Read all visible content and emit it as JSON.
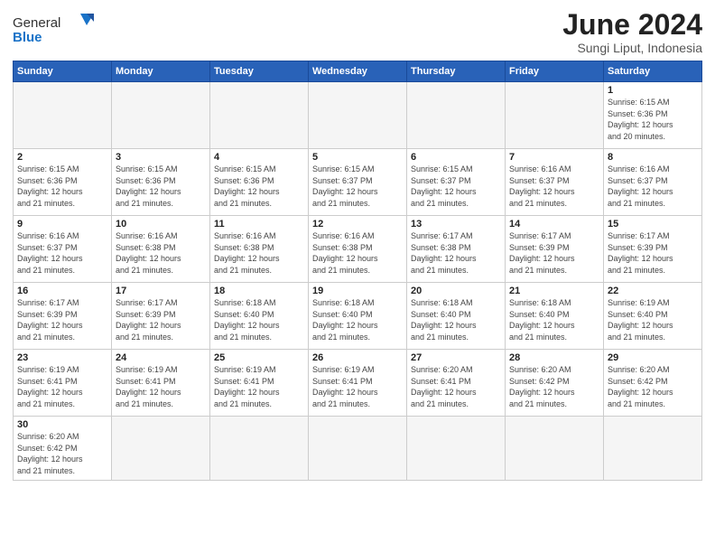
{
  "header": {
    "logo_general": "General",
    "logo_blue": "Blue",
    "month_title": "June 2024",
    "subtitle": "Sungi Liput, Indonesia"
  },
  "weekdays": [
    "Sunday",
    "Monday",
    "Tuesday",
    "Wednesday",
    "Thursday",
    "Friday",
    "Saturday"
  ],
  "days": {
    "d1": {
      "num": "1",
      "info": "Sunrise: 6:15 AM\nSunset: 6:36 PM\nDaylight: 12 hours\nand 20 minutes."
    },
    "d2": {
      "num": "2",
      "info": "Sunrise: 6:15 AM\nSunset: 6:36 PM\nDaylight: 12 hours\nand 21 minutes."
    },
    "d3": {
      "num": "3",
      "info": "Sunrise: 6:15 AM\nSunset: 6:36 PM\nDaylight: 12 hours\nand 21 minutes."
    },
    "d4": {
      "num": "4",
      "info": "Sunrise: 6:15 AM\nSunset: 6:36 PM\nDaylight: 12 hours\nand 21 minutes."
    },
    "d5": {
      "num": "5",
      "info": "Sunrise: 6:15 AM\nSunset: 6:37 PM\nDaylight: 12 hours\nand 21 minutes."
    },
    "d6": {
      "num": "6",
      "info": "Sunrise: 6:15 AM\nSunset: 6:37 PM\nDaylight: 12 hours\nand 21 minutes."
    },
    "d7": {
      "num": "7",
      "info": "Sunrise: 6:16 AM\nSunset: 6:37 PM\nDaylight: 12 hours\nand 21 minutes."
    },
    "d8": {
      "num": "8",
      "info": "Sunrise: 6:16 AM\nSunset: 6:37 PM\nDaylight: 12 hours\nand 21 minutes."
    },
    "d9": {
      "num": "9",
      "info": "Sunrise: 6:16 AM\nSunset: 6:37 PM\nDaylight: 12 hours\nand 21 minutes."
    },
    "d10": {
      "num": "10",
      "info": "Sunrise: 6:16 AM\nSunset: 6:38 PM\nDaylight: 12 hours\nand 21 minutes."
    },
    "d11": {
      "num": "11",
      "info": "Sunrise: 6:16 AM\nSunset: 6:38 PM\nDaylight: 12 hours\nand 21 minutes."
    },
    "d12": {
      "num": "12",
      "info": "Sunrise: 6:16 AM\nSunset: 6:38 PM\nDaylight: 12 hours\nand 21 minutes."
    },
    "d13": {
      "num": "13",
      "info": "Sunrise: 6:17 AM\nSunset: 6:38 PM\nDaylight: 12 hours\nand 21 minutes."
    },
    "d14": {
      "num": "14",
      "info": "Sunrise: 6:17 AM\nSunset: 6:39 PM\nDaylight: 12 hours\nand 21 minutes."
    },
    "d15": {
      "num": "15",
      "info": "Sunrise: 6:17 AM\nSunset: 6:39 PM\nDaylight: 12 hours\nand 21 minutes."
    },
    "d16": {
      "num": "16",
      "info": "Sunrise: 6:17 AM\nSunset: 6:39 PM\nDaylight: 12 hours\nand 21 minutes."
    },
    "d17": {
      "num": "17",
      "info": "Sunrise: 6:17 AM\nSunset: 6:39 PM\nDaylight: 12 hours\nand 21 minutes."
    },
    "d18": {
      "num": "18",
      "info": "Sunrise: 6:18 AM\nSunset: 6:40 PM\nDaylight: 12 hours\nand 21 minutes."
    },
    "d19": {
      "num": "19",
      "info": "Sunrise: 6:18 AM\nSunset: 6:40 PM\nDaylight: 12 hours\nand 21 minutes."
    },
    "d20": {
      "num": "20",
      "info": "Sunrise: 6:18 AM\nSunset: 6:40 PM\nDaylight: 12 hours\nand 21 minutes."
    },
    "d21": {
      "num": "21",
      "info": "Sunrise: 6:18 AM\nSunset: 6:40 PM\nDaylight: 12 hours\nand 21 minutes."
    },
    "d22": {
      "num": "22",
      "info": "Sunrise: 6:19 AM\nSunset: 6:40 PM\nDaylight: 12 hours\nand 21 minutes."
    },
    "d23": {
      "num": "23",
      "info": "Sunrise: 6:19 AM\nSunset: 6:41 PM\nDaylight: 12 hours\nand 21 minutes."
    },
    "d24": {
      "num": "24",
      "info": "Sunrise: 6:19 AM\nSunset: 6:41 PM\nDaylight: 12 hours\nand 21 minutes."
    },
    "d25": {
      "num": "25",
      "info": "Sunrise: 6:19 AM\nSunset: 6:41 PM\nDaylight: 12 hours\nand 21 minutes."
    },
    "d26": {
      "num": "26",
      "info": "Sunrise: 6:19 AM\nSunset: 6:41 PM\nDaylight: 12 hours\nand 21 minutes."
    },
    "d27": {
      "num": "27",
      "info": "Sunrise: 6:20 AM\nSunset: 6:41 PM\nDaylight: 12 hours\nand 21 minutes."
    },
    "d28": {
      "num": "28",
      "info": "Sunrise: 6:20 AM\nSunset: 6:42 PM\nDaylight: 12 hours\nand 21 minutes."
    },
    "d29": {
      "num": "29",
      "info": "Sunrise: 6:20 AM\nSunset: 6:42 PM\nDaylight: 12 hours\nand 21 minutes."
    },
    "d30": {
      "num": "30",
      "info": "Sunrise: 6:20 AM\nSunset: 6:42 PM\nDaylight: 12 hours\nand 21 minutes."
    }
  }
}
